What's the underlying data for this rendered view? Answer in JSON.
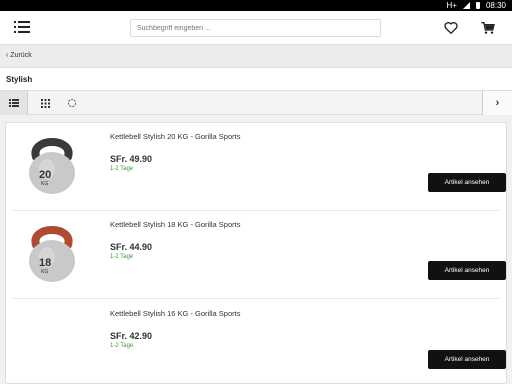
{
  "status": {
    "network": "H+",
    "time": "08:30"
  },
  "header": {
    "search": {
      "placeholder": "Suchbegriff eingeben ...",
      "value": ""
    },
    "icons": {
      "menu": "menu-icon",
      "wishlist": "heart-icon",
      "cart": "cart-icon"
    }
  },
  "nav": {
    "back_label": "Zurück"
  },
  "category": {
    "title": "Stylish"
  },
  "view_toggle": {
    "active": "list",
    "icons": [
      "list-icon",
      "grid-icon",
      "loading-icon"
    ],
    "next": "chevron-right-icon"
  },
  "products": [
    {
      "name": "Kettlebell Stylish 20 KG - Gorilla Sports",
      "price": "SFr. 49.90",
      "delivery": "1-2 Tage",
      "button": "Artikel ansehen",
      "weight_badge": "20",
      "unit": "KG",
      "handle_color": "#3a3a3a"
    },
    {
      "name": "Kettlebell Stylish 18 KG - Gorilla Sports",
      "price": "SFr. 44.90",
      "delivery": "1-2 Tage",
      "button": "Artikel ansehen",
      "weight_badge": "18",
      "unit": "KG",
      "handle_color": "#b04a32"
    },
    {
      "name": "Kettlebell Stylish 16 KG - Gorilla Sports",
      "price": "SFr. 42.90",
      "delivery": "1-2 Tage",
      "button": "Artikel ansehen",
      "weight_badge": "",
      "unit": "",
      "handle_color": ""
    }
  ],
  "colors": {
    "buy_button": "#111111",
    "delivery_text": "#3a9a3a"
  }
}
